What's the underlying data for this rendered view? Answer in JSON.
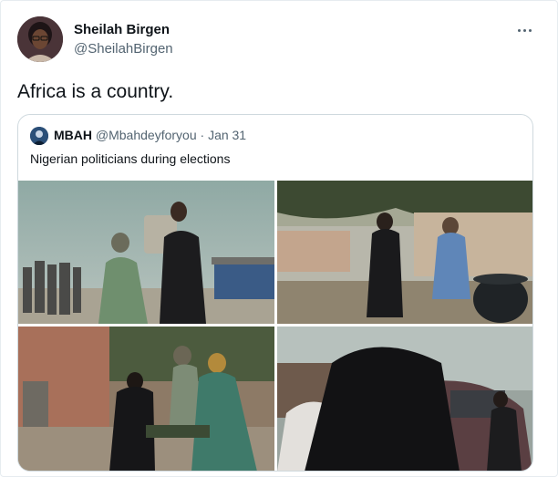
{
  "tweet": {
    "author": {
      "name": "Sheilah Birgen",
      "handle": "@SheilahBirgen",
      "avatar_icon": "profile-photo"
    },
    "more_icon": "more-horizontal-icon",
    "text": "Africa is a country."
  },
  "quoted_tweet": {
    "author": {
      "name": "MBAH",
      "handle": "@Mbahdeyforyou",
      "avatar_icon": "profile-photo"
    },
    "separator": "·",
    "date": "Jan 31",
    "text": "Nigerian politicians during elections",
    "media": [
      {
        "label": "photo-1"
      },
      {
        "label": "photo-2"
      },
      {
        "label": "photo-3"
      },
      {
        "label": "photo-4"
      }
    ]
  },
  "colors": {
    "text_primary": "#0f1419",
    "text_secondary": "#536471",
    "border": "#cfd9de"
  }
}
